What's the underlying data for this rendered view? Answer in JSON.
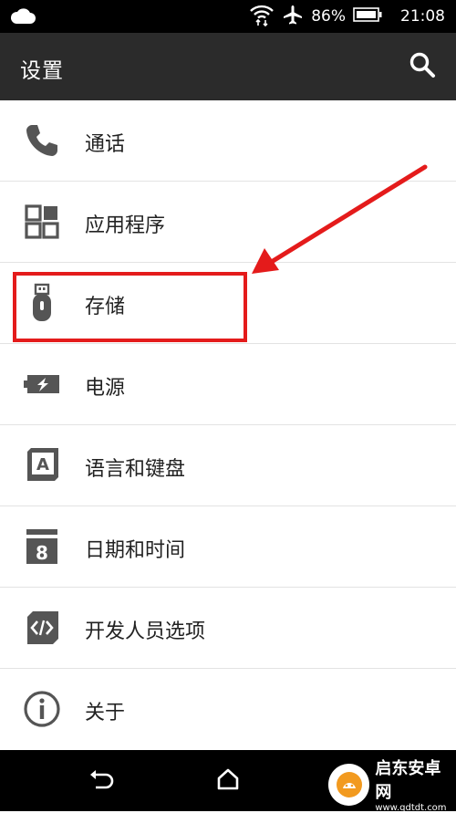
{
  "status_bar": {
    "battery": "86%",
    "time": "21:08"
  },
  "app_bar": {
    "title": "设置"
  },
  "settings_items": [
    {
      "label": "通话",
      "icon": "phone-icon"
    },
    {
      "label": "应用程序",
      "icon": "apps-grid-icon"
    },
    {
      "label": "存储",
      "icon": "usb-storage-icon"
    },
    {
      "label": "电源",
      "icon": "battery-charging-icon"
    },
    {
      "label": "语言和键盘",
      "icon": "language-keyboard-icon"
    },
    {
      "label": "日期和时间",
      "icon": "calendar-icon"
    },
    {
      "label": "开发人员选项",
      "icon": "code-icon"
    },
    {
      "label": "关于",
      "icon": "info-icon"
    }
  ],
  "calendar_day": "8",
  "watermark": {
    "title": "启东安卓网",
    "url": "www.qdtdt.com"
  },
  "colors": {
    "app_bar": "#2b2b2b",
    "icon_gray": "#555555",
    "annotation_red": "#e41b1b"
  }
}
